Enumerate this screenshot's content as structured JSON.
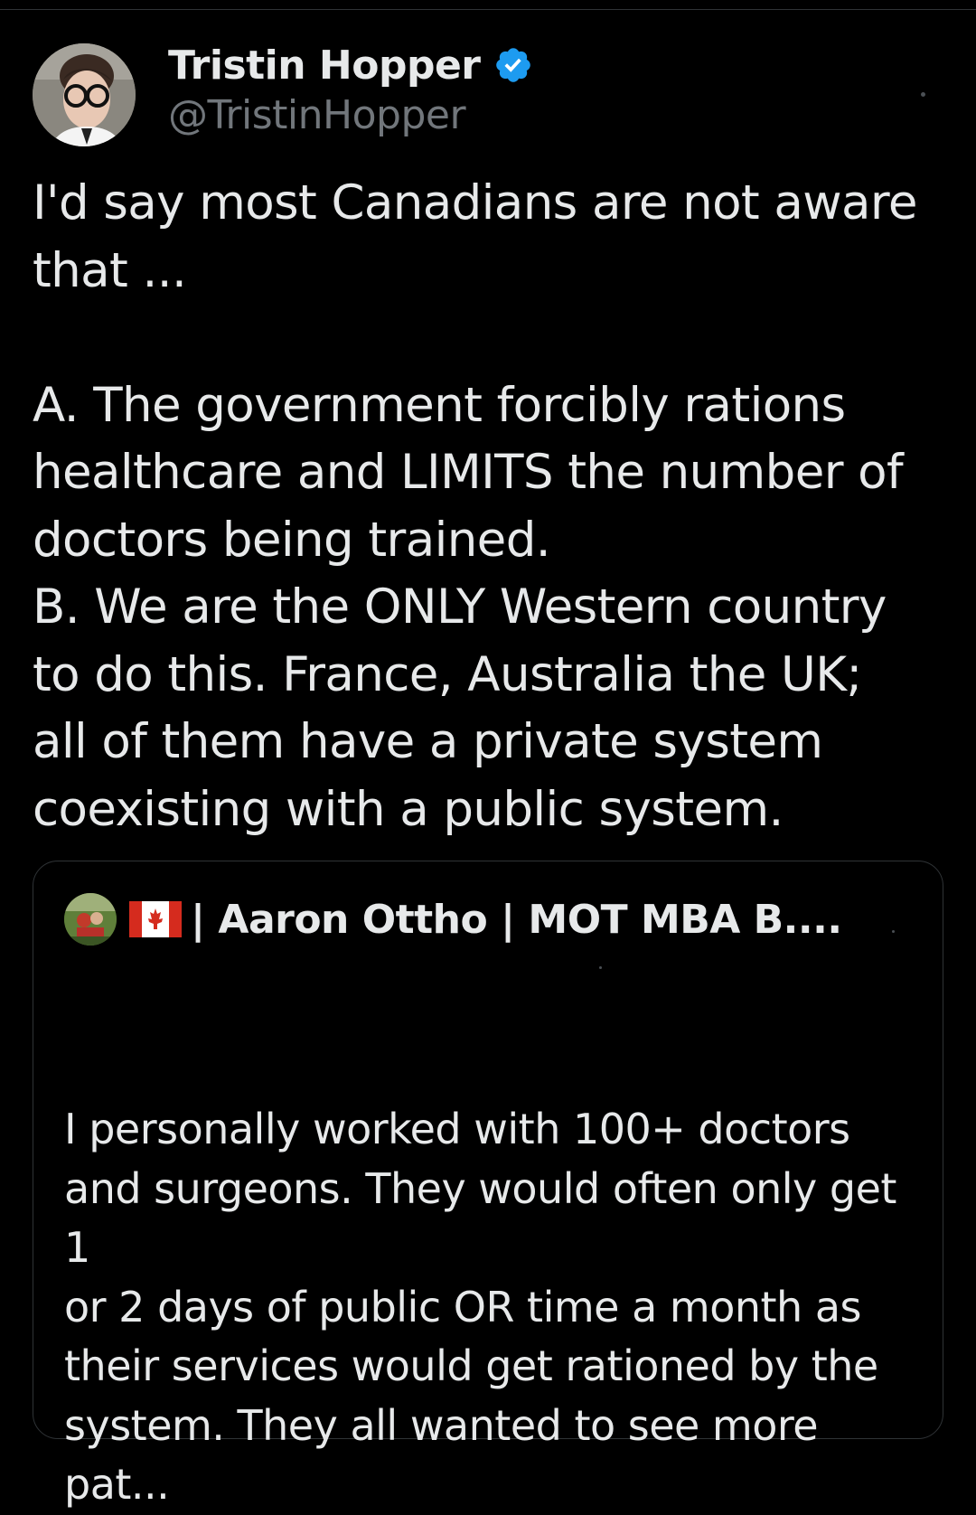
{
  "tweet": {
    "author": {
      "display_name": "Tristin Hopper",
      "handle": "@TristinHopper",
      "verified_icon": "verified-badge-icon"
    },
    "text_lines": [
      "I'd say most Canadians are not aware",
      "that ...",
      "",
      "A. The government forcibly rations",
      "healthcare and LIMITS the number of",
      "doctors being trained.",
      "B. We are the ONLY Western country",
      "to do this. France, Australia the UK;",
      "all of them have a private system",
      "coexisting with a public system."
    ]
  },
  "quoted_tweet": {
    "author": {
      "display_name": "| Aaron Ottho | MOT MBA B....",
      "flag_icon": "canada-flag-icon"
    },
    "text_lines": [
      "I personally worked with 100+ doctors",
      "and surgeons. They would often only get 1",
      "or 2 days of public OR time a month as",
      "their services would get rationed by the",
      "system. They all wanted to see more pat..."
    ]
  },
  "colors": {
    "background": "#000000",
    "primary_text": "#e7e9ea",
    "secondary_text": "#71767b",
    "border": "#2f3336",
    "verified_blue": "#1d9bf0",
    "flag_red": "#d52b1e"
  }
}
